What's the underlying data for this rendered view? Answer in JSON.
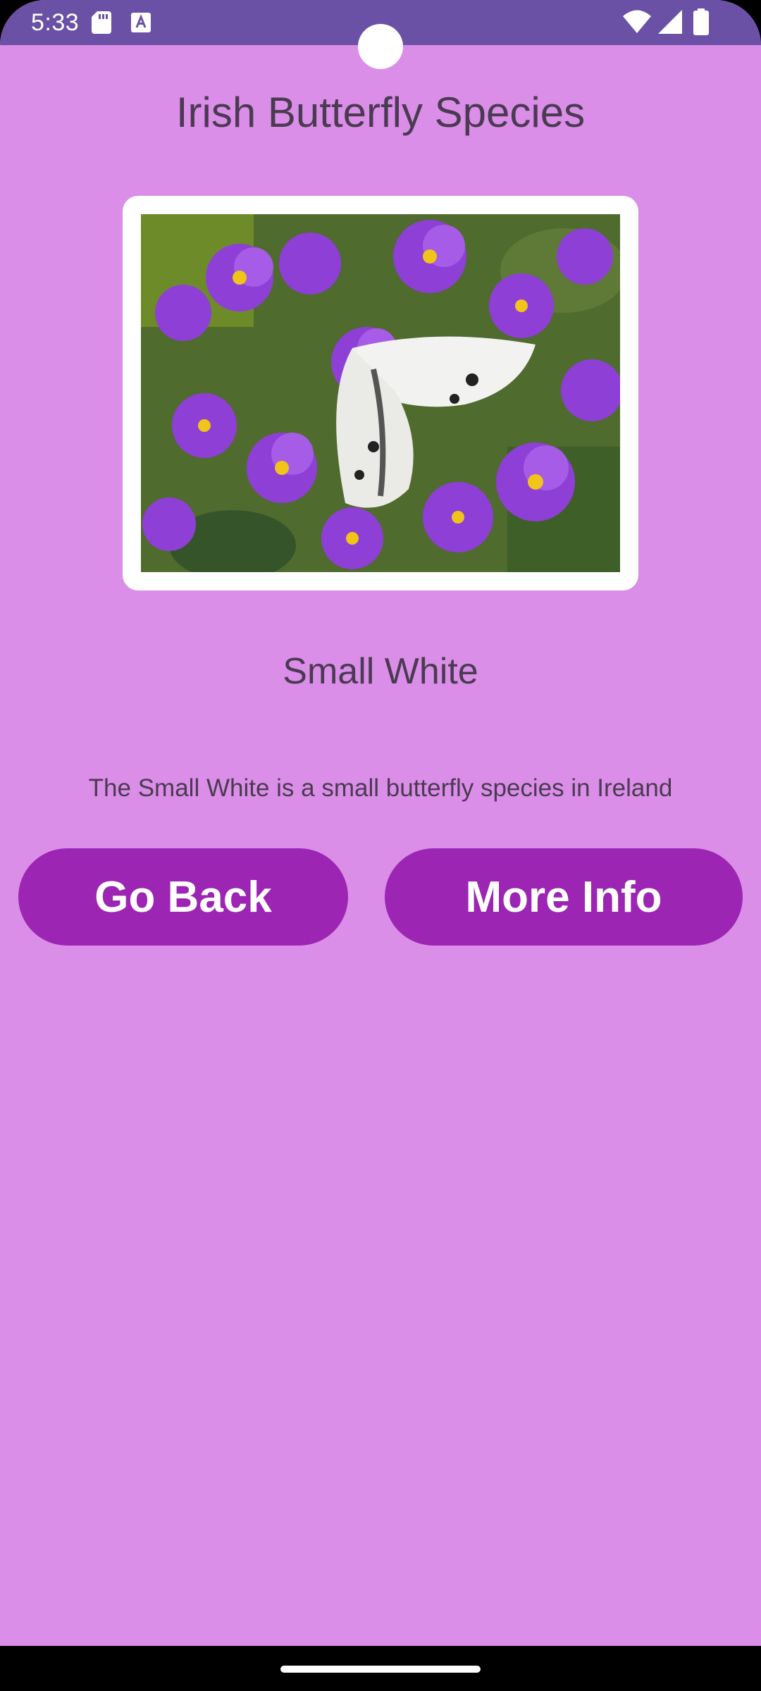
{
  "status_bar": {
    "time": "5:33",
    "icons": [
      "sd-card-icon",
      "text-a-icon",
      "wifi-icon",
      "signal-icon",
      "battery-icon"
    ]
  },
  "page": {
    "title": "Irish Butterfly Species"
  },
  "species": {
    "image_alt": "Small White butterfly on purple flowers",
    "name": "Small White",
    "description": "The Small White is a small butterfly species in Ireland"
  },
  "buttons": {
    "back_label": "Go Back",
    "more_label": "More Info"
  },
  "colors": {
    "background": "#da8ee7",
    "status_bar": "#6a51a6",
    "button": "#9c25b3",
    "text": "#4a3a52"
  }
}
